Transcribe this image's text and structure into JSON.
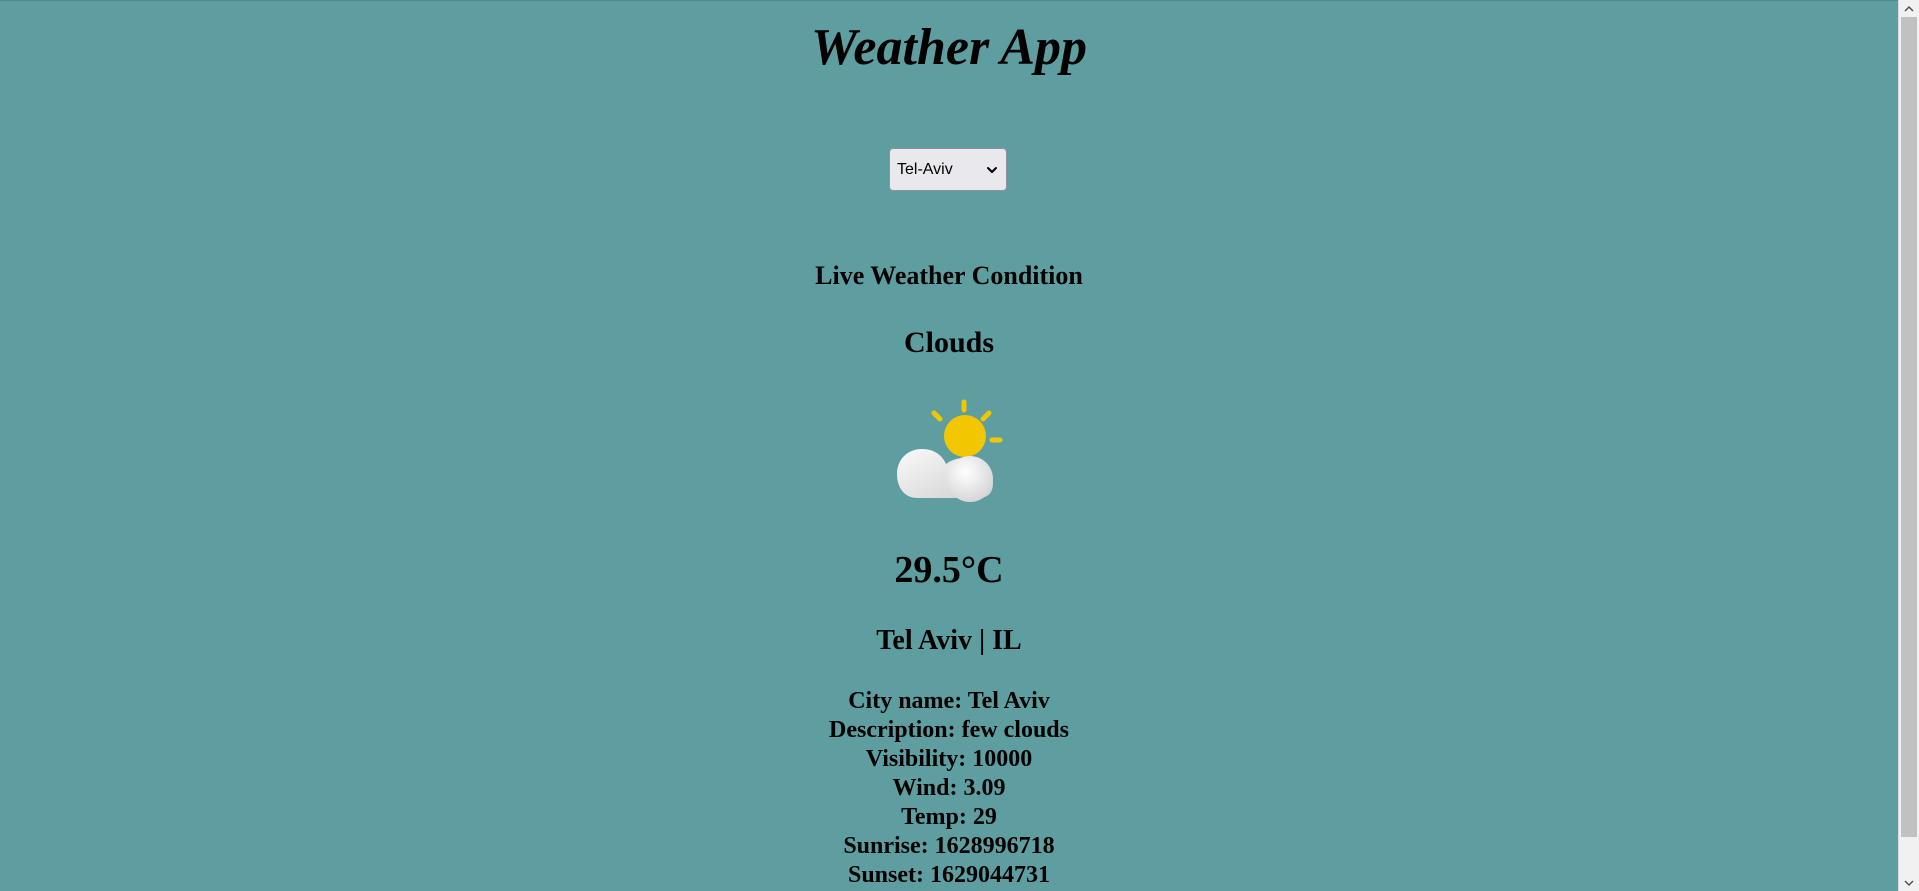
{
  "header": {
    "title": "Weather App"
  },
  "city_select": {
    "selected": "Tel-Aviv"
  },
  "main": {
    "section_heading": "Live Weather Condition",
    "condition": "Clouds",
    "icon": "sun-behind-cloud-icon",
    "temperature": "29.5°C",
    "location": "Tel Aviv | IL"
  },
  "details": [
    "City name: Tel Aviv",
    "Description: few clouds",
    "Visibility: 10000",
    "Wind: 3.09",
    "Temp: 29",
    "Sunrise: 1628996718",
    "Sunset: 1629044731"
  ],
  "colors": {
    "background": "#5f9ea0",
    "sun": "#f2c700",
    "cloud": "#e8e8e8"
  }
}
